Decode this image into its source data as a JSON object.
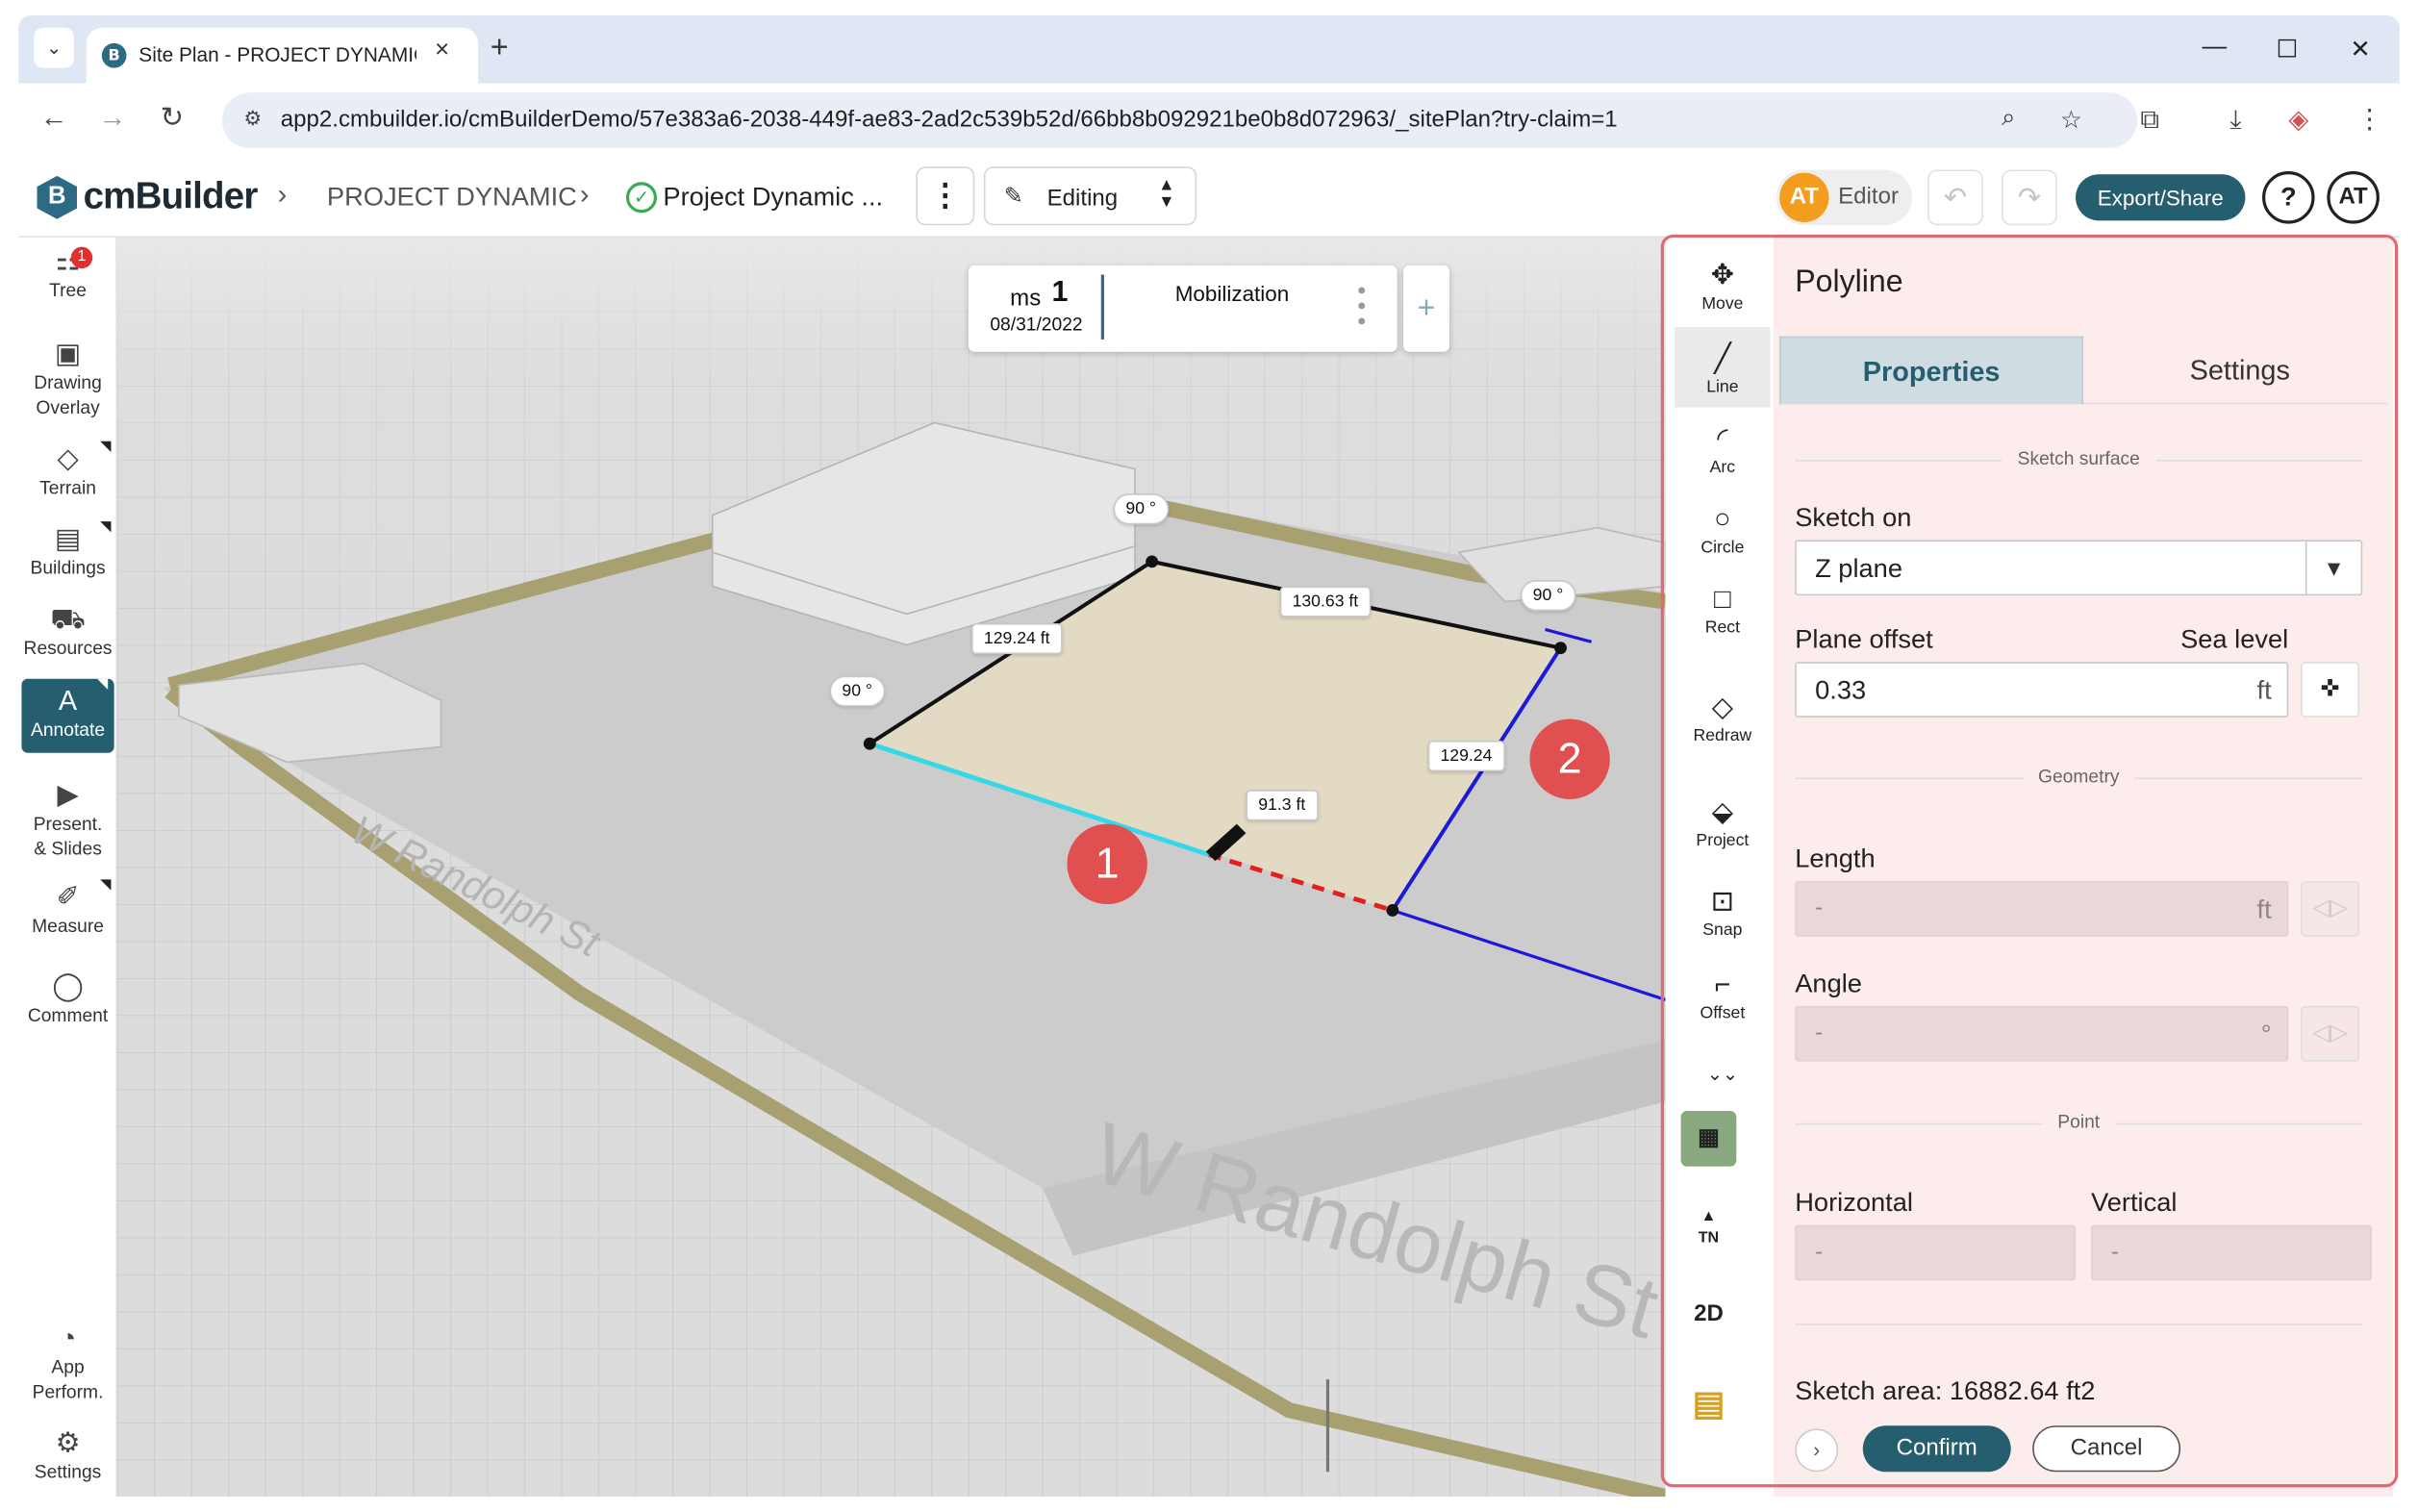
{
  "browser": {
    "tab_title": "Site Plan - PROJECT DYNAMIC",
    "tab_favicon": "B",
    "url": "app2.cmbuilder.io/cmBuilderDemo/57e383a6-2038-449f-ae83-2ad2c539b52d/66bb8b092921be0b8d072963/_sitePlan?try-claim=1"
  },
  "header": {
    "logo_mark": "B",
    "logo_text": "cmBuilder",
    "breadcrumb_project": "PROJECT DYNAMIC",
    "breadcrumb_plan": "Project Dynamic ...",
    "mode": "Editing",
    "editor_initials": "AT",
    "editor_role": "Editor",
    "export_label": "Export/Share",
    "help_label": "?",
    "user_initials": "AT"
  },
  "sidebar": {
    "tree_badge": "1",
    "items": [
      {
        "label": "Tree",
        "icon": "tree-icon"
      },
      {
        "label": "Drawing Overlay",
        "icon": "image-icon"
      },
      {
        "label": "Terrain",
        "icon": "terrain-icon"
      },
      {
        "label": "Buildings",
        "icon": "building-icon"
      },
      {
        "label": "Resources",
        "icon": "resources-icon"
      },
      {
        "label": "Annotate",
        "icon": "annotate-icon"
      },
      {
        "label": "Present. & Slides",
        "icon": "presentation-icon"
      },
      {
        "label": "Measure",
        "icon": "ruler-icon"
      },
      {
        "label": "Comment",
        "icon": "comment-icon"
      },
      {
        "label": "App Perform.",
        "icon": "gauge-icon"
      },
      {
        "label": "Settings",
        "icon": "gear-icon"
      }
    ]
  },
  "milestone": {
    "prefix": "ms",
    "number": "1",
    "date": "08/31/2022",
    "name": "Mobilization",
    "add_label": "+"
  },
  "canvas": {
    "dims": {
      "top": "130.63 ft",
      "left": "129.24 ft",
      "right": "129.24",
      "current": "91.3 ft",
      "angle_top": "90 °",
      "angle_left": "90 °",
      "angle_right": "90 °"
    },
    "street_top": "W Randolph St",
    "street_bottom": "W Randolph St",
    "callouts": [
      "1",
      "2"
    ]
  },
  "tools": {
    "drawing": [
      {
        "label": "Move",
        "icon": "move-icon"
      },
      {
        "label": "Line",
        "icon": "line-icon"
      },
      {
        "label": "Arc",
        "icon": "arc-icon"
      },
      {
        "label": "Circle",
        "icon": "circle-icon"
      },
      {
        "label": "Rect",
        "icon": "rect-icon"
      }
    ],
    "redraw": "Redraw",
    "modifiers": [
      {
        "label": "Project",
        "icon": "project-icon"
      },
      {
        "label": "Snap",
        "icon": "snap-icon"
      },
      {
        "label": "Offset",
        "icon": "offset-icon"
      }
    ],
    "compass_label": "TN",
    "view_2d_label": "2D"
  },
  "panel": {
    "title": "Polyline",
    "tabs": [
      "Properties",
      "Settings"
    ],
    "sketch_surface_section": "Sketch surface",
    "sketch_on_label": "Sketch on",
    "sketch_on_value": "Z plane",
    "plane_offset_label": "Plane offset",
    "sea_level_label": "Sea level",
    "plane_offset_value": "0.33",
    "plane_offset_unit": "ft",
    "geometry_section": "Geometry",
    "length_label": "Length",
    "length_value": "-",
    "length_unit": "ft",
    "angle_label": "Angle",
    "angle_value": "-",
    "angle_unit": "°",
    "point_section": "Point",
    "horizontal_label": "Horizontal",
    "horizontal_value": "-",
    "vertical_label": "Vertical",
    "vertical_value": "-",
    "sketch_area": "Sketch area: 16882.64 ft2",
    "confirm_label": "Confirm",
    "cancel_label": "Cancel"
  },
  "colors": {
    "brand": "#255e6e",
    "highlight": "#e16a72",
    "callout": "#e05050",
    "active_segment": "#34d8e8",
    "preview_segment": "#e02020",
    "guide_line": "#2020d0"
  }
}
